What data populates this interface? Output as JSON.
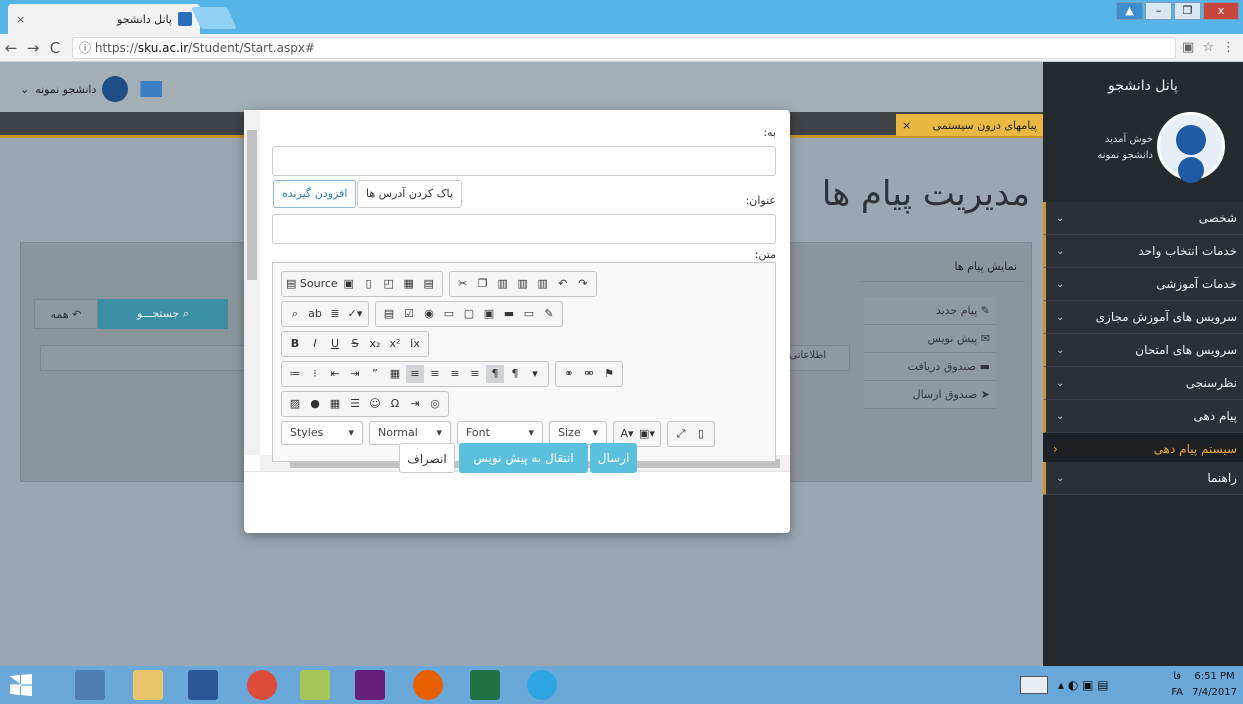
{
  "browser": {
    "tab_title": "پانل دانشجو",
    "tab_close": "×",
    "url_scheme": "https://",
    "url_host": "sku.ac.ir",
    "url_path": "/Student/Start.aspx#",
    "back": "←",
    "forward": "→",
    "reload": "C",
    "info": "ⓘ",
    "star": "☆",
    "menu": "⋮",
    "win_min": "–",
    "win_max": "❐",
    "win_close": "x",
    "win_extra": "▲"
  },
  "header": {
    "username": "دانشجو نمونه",
    "dropdown": "⌄"
  },
  "notice": {
    "label": "پیامهای درون سیستمی",
    "close": "×"
  },
  "page": {
    "title": "مدیریت پیام ها",
    "panel_heading": "نمایش پیام ها",
    "search_label": "جستجـــو",
    "search_icon": "search-icon",
    "all_label": "همه",
    "info_text": "اطلاعاتی م",
    "folders": [
      {
        "label": "✎ پیام جدید"
      },
      {
        "label": "✉ پیش نویس"
      },
      {
        "label": "▬ صندوق دریافت"
      },
      {
        "label": "➤ صندوق ارسال"
      }
    ]
  },
  "sidebar": {
    "title": "پانل دانشجو",
    "welcome": "خوش آمدید",
    "student": "دانشجو نمونه",
    "items": [
      {
        "label": "شخصی"
      },
      {
        "label": "خدمات انتخاب واحد"
      },
      {
        "label": "خدمات آموزشی"
      },
      {
        "label": "سرویس های آموزش مجازی"
      },
      {
        "label": "سرویس های امتحان"
      },
      {
        "label": "نظرسنجی"
      },
      {
        "label": "پیام دهی"
      }
    ],
    "sub_item": "سیستم پیام دهی",
    "last_item": "راهنما"
  },
  "modal": {
    "to_label": "به:",
    "subject_label": "عنوان:",
    "body_label": "متن:",
    "add_recipient": "افزودن گیرنده",
    "clear_addresses": "پاک کردن آدرس ها",
    "toolbar_source": "Source",
    "combo_styles": "Styles",
    "combo_format": "Normal",
    "combo_font": "Font",
    "combo_size": "Size",
    "send": "ارسال",
    "to_draft": "انتقال به پیش نویس",
    "cancel": "انصراف"
  },
  "taskbar": {
    "lang_top": "فا",
    "lang_bottom": "FA",
    "time": "6:51 PM",
    "date": "7/4/2017"
  },
  "colors": {
    "accent": "#c8962c",
    "send": "#5bc0de",
    "sidebar": "#252a2e"
  }
}
